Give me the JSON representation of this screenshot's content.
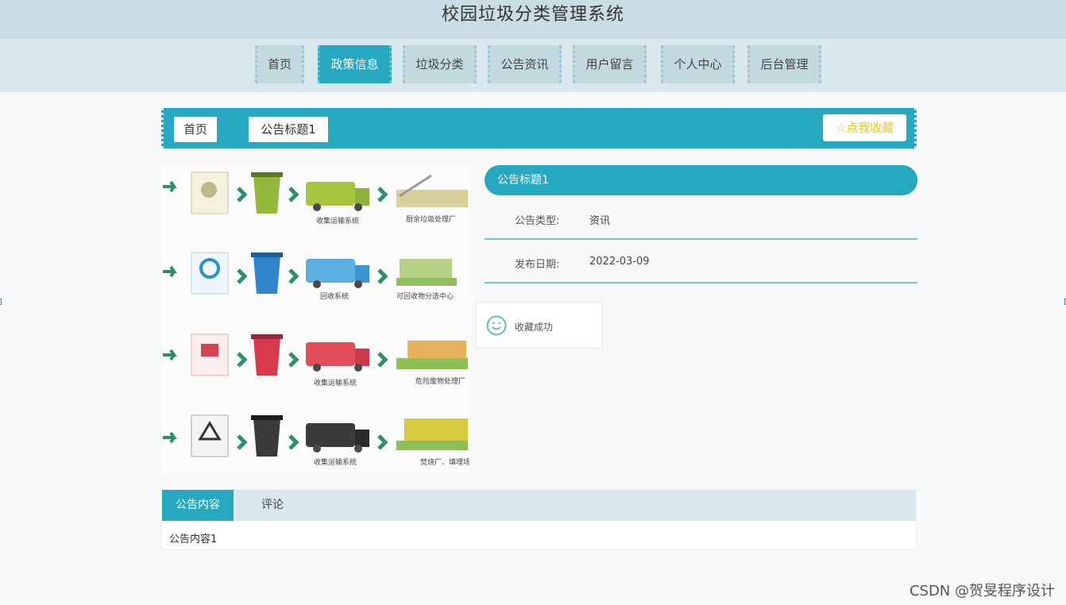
{
  "header": {
    "title": "校园垃圾分类管理系统"
  },
  "nav": {
    "items": [
      "首页",
      "政策信息",
      "垃圾分类",
      "公告资讯",
      "用户留言",
      "个人中心",
      "后台管理"
    ],
    "active_index": 1
  },
  "breadcrumb": {
    "home": "首页",
    "current": "公告标题1"
  },
  "favorite_button": {
    "label": "☆点我收藏"
  },
  "image": {
    "captions": [
      "收集运输系统",
      "厨余垃圾处理厂",
      "回收系统",
      "可回收物分选中心",
      "收集运输系统",
      "危险废物处理厂",
      "收集运输系统",
      "焚烧厂、填埋场"
    ]
  },
  "detail": {
    "title": "公告标题1",
    "type_label": "公告类型:",
    "type_value": "资讯",
    "date_label": "发布日期:",
    "date_value": "2022-03-09"
  },
  "toast": {
    "message": "收藏成功"
  },
  "tabs": {
    "content_tab": "公告内容",
    "comment_tab": "评论",
    "content": "公告内容1"
  },
  "watermark": "CSDN @贺旻程序设计",
  "colors": {
    "accent": "#26a8c0",
    "nav_bg": "#d9e8ee",
    "title_bg": "#c9dde4",
    "star": "#f5c520",
    "divider": "#6cc7c9"
  }
}
